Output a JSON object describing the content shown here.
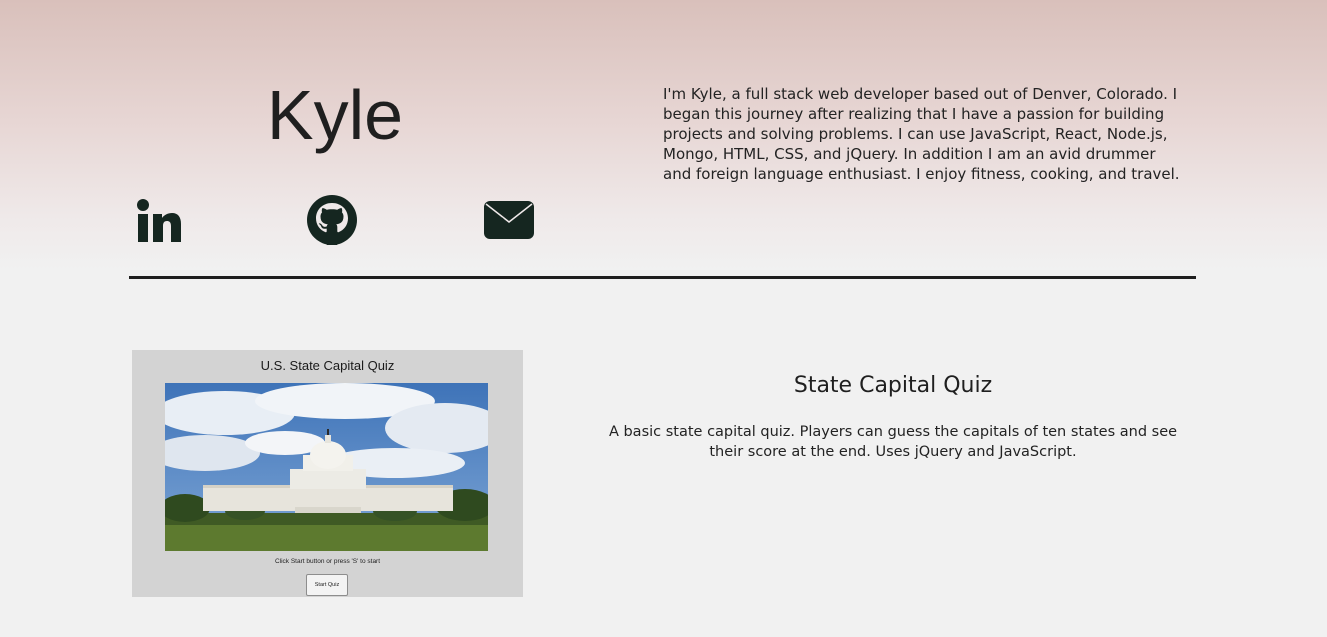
{
  "header": {
    "name": "Kyle",
    "bio": "I'm Kyle, a full stack web developer based out of Denver, Colorado. I began this journey after realizing that I have a passion for building projects and solving problems. I can use JavaScript, React, Node.js, Mongo, HTML, CSS, and jQuery. In addition I am an avid drummer and foreign language enthusiast. I enjoy fitness, cooking, and travel.",
    "social": [
      {
        "icon": "linkedin-icon"
      },
      {
        "icon": "github-icon"
      },
      {
        "icon": "email-icon"
      }
    ]
  },
  "project": {
    "title": "State Capital Quiz",
    "description": "A basic state capital quiz. Players can guess the capitals of ten states and see their score at the end. Uses jQuery and JavaScript.",
    "screenshot": {
      "title": "U.S. State Capital Quiz",
      "caption": "Click Start button or press 'S' to start",
      "button_label": "Start Quiz"
    }
  },
  "colors": {
    "text": "#1b1b1b",
    "divider": "#1e1e1e",
    "icon": "#152620",
    "background": "#f1f1f1"
  }
}
